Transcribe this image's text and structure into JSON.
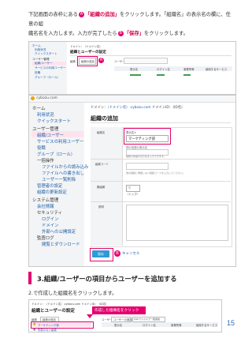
{
  "intro": {
    "line1_a": "下記画面の赤枠にある",
    "badge_a": "A",
    "line1_b": "「組織の追加」",
    "line1_c": "をクリックします。「組織名」の表示名の欄に、任意の組",
    "line2_a": "織名名を入力します。入力が完了したら",
    "badge_b": "B",
    "line2_b": "「保存」",
    "line2_c": "をクリックします。"
  },
  "shot1": {
    "nav": [
      "ホーム",
      "利用状況",
      "クイックスタート",
      "ユーザー管理",
      "組織/ユーザー",
      "サービスの利用ユーザー",
      "役職",
      "グループ（ロール）"
    ],
    "breadcrumb": "ドメイン：（ドメイン名）",
    "title": "組織とユーザーの設定",
    "tab_org": "組織",
    "add_button": "組織の追加",
    "badge": "A",
    "user_tab": "ユーザー",
    "col1": "表示名",
    "col2": "ログイン名",
    "col3": "事業所等",
    "col4": "使用するサービス"
  },
  "header_logo": "cybozu.com",
  "shot2": {
    "nav": {
      "home": "ホーム",
      "usage": "利用状況",
      "quickstart": "クイックスタート",
      "user_admin": "ユーザー管理",
      "org_user": "組織/ユーザー",
      "service_users": "サービスの利用ユーザー",
      "position": "役職",
      "group": "グループ（ロール）",
      "bulk": "一括操作",
      "file_read": "ファイルからの読み込み",
      "file_write": "ファイルへの書き出し",
      "user_list": "ユーザー一覧削除",
      "admin_settings": "管理者の設定",
      "org_admin": "組織の更新設定",
      "system_admin": "システム管理",
      "company": "会社情報",
      "security": "セキュリティ",
      "login": "ログイン",
      "domain": "ドメイン",
      "external": "外部への公開設定",
      "audit": "監査ログ",
      "download": "閲覧とダウンロード"
    },
    "breadcrumb_prefix": "ドメイン：",
    "breadcrumb_domain": "（ドメイン名）.cybozu.com",
    "breadcrumb_id": "ドメインID：（ID名）",
    "title": "組織の追加",
    "field_org_name": "組織名",
    "display_name_label": "表示名＊",
    "display_name_value": "マーケティング部",
    "other_lang_label": "別の言語の表示名",
    "lang_note": "複数の言語の表示名を入力できます。",
    "org_code_label": "組織コード",
    "org_code_note": "他の組織と重複しない組織コードを入力してください。",
    "parent_label": "親組織",
    "parent_value": "（トップ）",
    "desc_label": "説明",
    "save_button": "保存",
    "badge": "B",
    "cancel_link": "キャンセル"
  },
  "section": {
    "heading": "3.組織/ユーザーの項目からユーザーを追加する",
    "sub": "2.で作成した組織名をクリックします。"
  },
  "shot3": {
    "breadcrumb": "ドメイン：（ドメイン名）.cybozu.com ドメインID：（ID名）",
    "title": "組織とユーザーの設定",
    "callout": "作成した組織名をクリック",
    "tab_org": "組織",
    "add_button": "組織の追加",
    "user_tab": "ユーザー",
    "user_add": "ユーザーの追加",
    "other_btn": "CSVファイルで一括追加",
    "org_item": "マーケティング部",
    "no_org_item": "所属のない組織",
    "col1": "表示名",
    "col2": "ログイン名",
    "col3": "事業所等",
    "col4": "使用するサービス"
  },
  "page_number": "15",
  "colors": {
    "accent": "#e5006e",
    "link": "#1f5fa8",
    "section_bar": "#e5006e",
    "page_number": "#2c6ebd"
  }
}
